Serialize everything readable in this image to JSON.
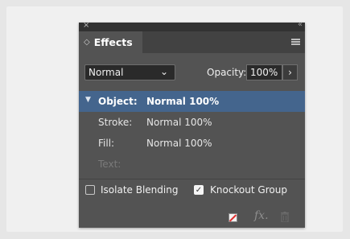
{
  "panel": {
    "close_glyph": "×",
    "collapse_glyph": "‹‹",
    "tab_icon": "◇",
    "tab_label": "Effects"
  },
  "blend": {
    "mode": "Normal",
    "mode_chevron": "⌄",
    "opacity_label": "Opacity:",
    "opacity_value": "100%",
    "opacity_arrow": "›"
  },
  "items": [
    {
      "label": "Object:",
      "value": "Normal 100%",
      "selected": true
    },
    {
      "label": "Stroke:",
      "value": "Normal 100%"
    },
    {
      "label": "Fill:",
      "value": "Normal 100%"
    },
    {
      "label": "Text:",
      "value": ""
    }
  ],
  "options": {
    "isolate_blending": "Isolate Blending",
    "isolate_checked": false,
    "knockout_group": "Knockout Group",
    "knockout_checked": true
  },
  "icons": {
    "clear_effects": "clear-effects-icon",
    "fx": "fx",
    "delete": "trash-icon"
  },
  "colors": {
    "panel_bg": "#535353",
    "selection": "#44658d",
    "title_bar": "#323232"
  }
}
